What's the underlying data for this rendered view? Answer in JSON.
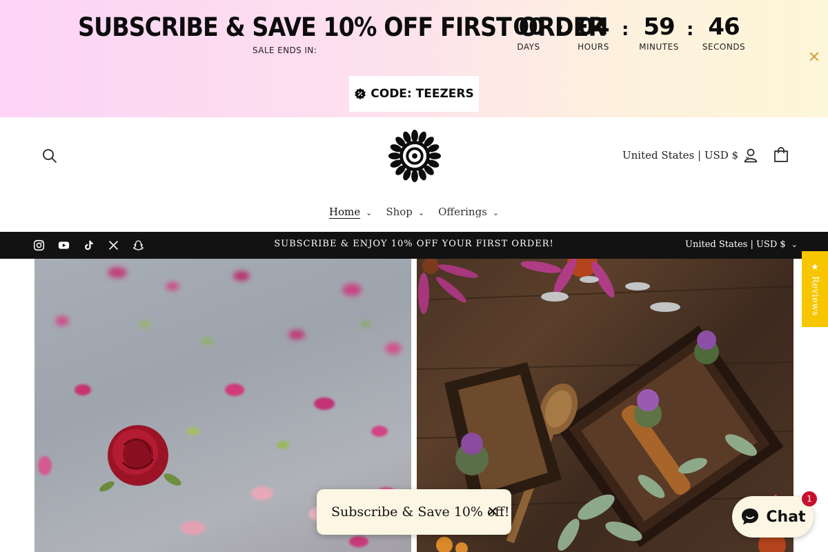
{
  "promo": {
    "title": "SUBSCRIBE & SAVE 10% OFF FIRST ORDER",
    "subtitle": "SALE ENDS IN:",
    "countdown": [
      {
        "value": "00",
        "label": "DAYS"
      },
      {
        "value": "04",
        "label": "HOURS"
      },
      {
        "value": "59",
        "label": "MINUTES"
      },
      {
        "value": "46",
        "label": "SECONDS"
      }
    ],
    "separator": ":",
    "close_icon": "close-icon",
    "code_icon": "badge-percent-icon",
    "code_text": "CODE: TEEZERS",
    "gradient_colors": [
      "#fcd4f6",
      "#fef6d8"
    ]
  },
  "header": {
    "search_icon": "search-icon",
    "logo": "sun-flower-logo",
    "locale": "United States | USD $",
    "account_icon": "account-icon",
    "cart_icon": "cart-icon",
    "nav": [
      {
        "label": "Home",
        "active": true
      },
      {
        "label": "Shop",
        "active": false
      },
      {
        "label": "Offerings",
        "active": false
      }
    ]
  },
  "announcement": {
    "socials": [
      "instagram-icon",
      "youtube-icon",
      "tiktok-icon",
      "x-icon",
      "snapchat-icon"
    ],
    "text": "SUBSCRIBE & ENJOY 10% OFF YOUR FIRST ORDER!",
    "locale": "United States | USD $",
    "background": "#121212"
  },
  "hero": {
    "left_image": "rose-petals-image",
    "right_image": "herbs-wooden-tray-image"
  },
  "reviews_tab": {
    "label": "★ Reviews",
    "color": "#f7c600"
  },
  "subscribe_popup": {
    "text": "Subscribe & Save 10% off!",
    "close": "✕"
  },
  "chat": {
    "label": "Chat",
    "badge": "1",
    "icon": "chat-bubble-icon"
  }
}
